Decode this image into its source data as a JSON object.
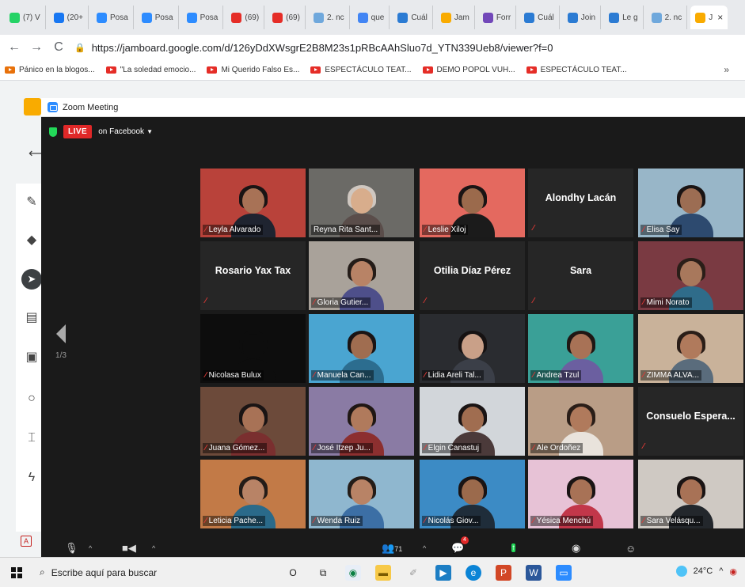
{
  "browser": {
    "tabs": [
      {
        "label": "(7) V",
        "color": "#25d366"
      },
      {
        "label": "(20+",
        "color": "#1877f2"
      },
      {
        "label": "Posa",
        "color": "#2d8cff"
      },
      {
        "label": "Posa",
        "color": "#2d8cff"
      },
      {
        "label": "Posa",
        "color": "#2d8cff"
      },
      {
        "label": "(69)",
        "color": "#e52d27"
      },
      {
        "label": "(69)",
        "color": "#e52d27"
      },
      {
        "label": "2. nc",
        "color": "#6fa8dc"
      },
      {
        "label": "que",
        "color": "#4285f4"
      },
      {
        "label": "Cuál",
        "color": "#2b7bd3"
      },
      {
        "label": "Jam",
        "color": "#f9ab00"
      },
      {
        "label": "Forr",
        "color": "#7248b9"
      },
      {
        "label": "Cuál",
        "color": "#2b7bd3"
      },
      {
        "label": "Join",
        "color": "#2b7bd3"
      },
      {
        "label": "Le g",
        "color": "#2b7bd3"
      },
      {
        "label": "2. nc",
        "color": "#6fa8dc"
      },
      {
        "label": "J",
        "color": "#f9ab00",
        "active": true
      }
    ],
    "close_glyph": "×",
    "url": "https://jamboard.google.com/d/126yDdXWsgrE2B8M23s1pRBcAAhSluo7d_YTN339Ueb8/viewer?f=0",
    "bookmarks": [
      "Pánico en la blogos...",
      "\"La soledad emocio...",
      "Mi Querido Falso Es...",
      "ESPECTÁCULO TEAT...",
      "DEMO POPOL VUH...",
      "ESPECTÁCULO TEAT..."
    ],
    "bookmarks_more": "»"
  },
  "zoom": {
    "window_title": "Zoom Meeting",
    "live_badge": "LIVE",
    "live_target": "on Facebook",
    "page_indicator": "1/3",
    "participants": [
      {
        "name": "Leyla Alvarado",
        "video": true,
        "bg": "#b9423a",
        "skin": "#a87256",
        "hair": "#1a1414",
        "shirt": "#1f2430"
      },
      {
        "name": "Reyna Rita Sant...",
        "video": true,
        "active": true,
        "bg": "#6b6a66",
        "skin": "#d8ad8c",
        "hair": "#cfc7c0",
        "shirt": "#5a4d4a"
      },
      {
        "name": "Leslie Xiloj",
        "video": true,
        "bg": "#e4695f",
        "skin": "#9b6a4c",
        "hair": "#1a1414",
        "shirt": "#1b1b1b"
      },
      {
        "name": "Alondhy Lacán",
        "video": false
      },
      {
        "name": "Elisa Say",
        "video": true,
        "bg": "#98b6c8",
        "skin": "#9c6d53",
        "hair": "#1a1414",
        "shirt": "#2d4a6f"
      },
      {
        "name": "Rosario Yax Tax",
        "video": false
      },
      {
        "name": "Gloria Gutier...",
        "video": true,
        "bg": "#a9a29a",
        "skin": "#b88366",
        "hair": "#241c18",
        "shirt": "#4e4f8a"
      },
      {
        "name": "Otilia Díaz Pérez",
        "video": false
      },
      {
        "name": "Sara",
        "video": false
      },
      {
        "name": "Mimi Norato",
        "video": true,
        "bg": "#7a3a42",
        "skin": "#a8785c",
        "hair": "#2a1e18",
        "shirt": "#2f6c8a"
      },
      {
        "name": "Nicolasa Bulux",
        "video": true,
        "bg": "#0d0d0d",
        "skin": "#0d0d0d",
        "hair": "#0d0d0d",
        "shirt": "#0d0d0d"
      },
      {
        "name": "Manuela Can...",
        "video": true,
        "bg": "#4aa5d1",
        "skin": "#a06d50",
        "hair": "#1a1414",
        "shirt": "#2c6d8f"
      },
      {
        "name": "Lidia Areli Tal...",
        "video": true,
        "bg": "#2a2c30",
        "skin": "#c9a088",
        "hair": "#161212",
        "shirt": "#3b3f48"
      },
      {
        "name": "Andrea Tzul",
        "video": true,
        "bg": "#3aa097",
        "skin": "#a87256",
        "hair": "#1f1714",
        "shirt": "#6b5fa0"
      },
      {
        "name": "ZIMMA ALVA...",
        "video": true,
        "bg": "#c9b29a",
        "skin": "#b07a5c",
        "hair": "#2a1e18",
        "shirt": "#5a6c7c"
      },
      {
        "name": "Juana Gómez...",
        "video": true,
        "bg": "#6c4a3a",
        "skin": "#a87256",
        "hair": "#1a1414",
        "shirt": "#7a2f2f"
      },
      {
        "name": "José Itzep Ju...",
        "video": true,
        "bg": "#8a7ba4",
        "skin": "#b07a5c",
        "hair": "#1f1714",
        "shirt": "#8c2f2f"
      },
      {
        "name": "Elgin Canastuj",
        "video": true,
        "bg": "#d2d6da",
        "skin": "#a06d50",
        "hair": "#1a1414",
        "shirt": "#4b3a3a"
      },
      {
        "name": "Ale Ordoñez",
        "video": true,
        "bg": "#b99d86",
        "skin": "#b07a5c",
        "hair": "#2a1e18",
        "shirt": "#e9e3dc"
      },
      {
        "name": "Consuelo  Espera...",
        "video": false
      },
      {
        "name": "Leticia  Pache...",
        "video": true,
        "bg": "#c27a47",
        "skin": "#b88366",
        "hair": "#241c18",
        "shirt": "#2a6a8a"
      },
      {
        "name": "Wenda Ruiz",
        "video": true,
        "bg": "#8fb7cf",
        "skin": "#b88366",
        "hair": "#241c18",
        "shirt": "#3c6fa5"
      },
      {
        "name": "Nicolás Giov...",
        "video": true,
        "bg": "#3c8bc5",
        "skin": "#9b6a4c",
        "hair": "#1a1414",
        "shirt": "#1f2d3a"
      },
      {
        "name": "Yésica Menchú",
        "video": true,
        "bg": "#e7c2d6",
        "skin": "#a87256",
        "hair": "#1a1414",
        "shirt": "#c2374a"
      },
      {
        "name": "Sara Velásqu...",
        "video": true,
        "bg": "#cfc9c3",
        "skin": "#a87256",
        "hair": "#1a1414",
        "shirt": "#23272c"
      }
    ],
    "controls": {
      "participants_count": "71",
      "reaction_badge": "4"
    },
    "accent": "#c8d84a",
    "live_color": "#e02828"
  },
  "jamboard": {
    "tools": [
      "pen-icon",
      "eraser-icon",
      "select-icon",
      "sticky-note-icon",
      "image-icon",
      "circle-icon",
      "text-box-icon",
      "laser-icon"
    ]
  },
  "taskbar": {
    "search_placeholder": "Escribe aquí para buscar",
    "cortana_glyph": "O",
    "temperature": "24°C",
    "tray_caret": "^"
  }
}
